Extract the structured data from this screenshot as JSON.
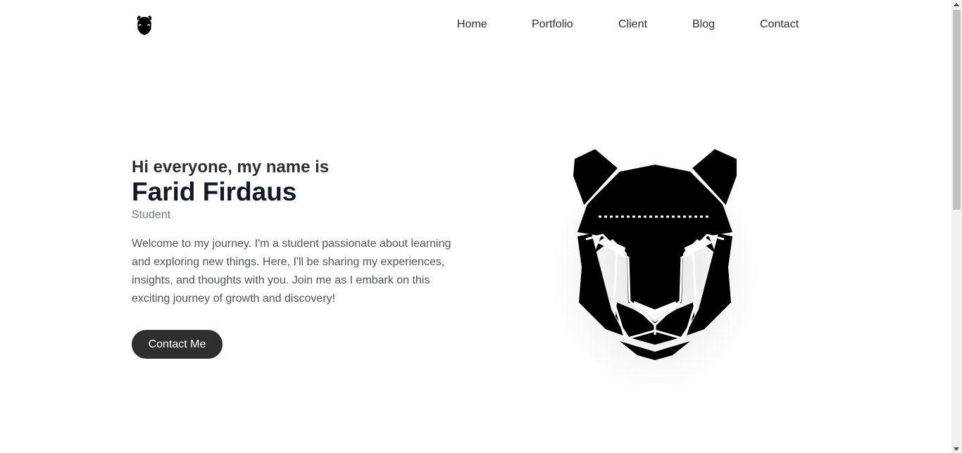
{
  "nav": {
    "logo_icon": "panther-head-logo-icon",
    "items": [
      {
        "label": "Home"
      },
      {
        "label": "Portfolio"
      },
      {
        "label": "Client"
      },
      {
        "label": "Blog"
      },
      {
        "label": "Contact"
      }
    ]
  },
  "hero": {
    "greeting": "Hi everyone, my name is",
    "name": "Farid Firdaus",
    "role": "Student",
    "intro": "Welcome to my journey. I'm a student passionate about learning and exploring new things. Here, I'll be sharing my experiences, insights, and thoughts with you. Join me as I embark on this exciting journey of growth and discovery!",
    "cta_label": "Contact Me",
    "illustration_icon": "panther-head-illustration"
  },
  "colors": {
    "text_dark": "#2f2f2f",
    "name_color": "#111827",
    "muted": "#6b7785",
    "button_bg": "#2f2f2f",
    "button_text": "#ffffff"
  }
}
